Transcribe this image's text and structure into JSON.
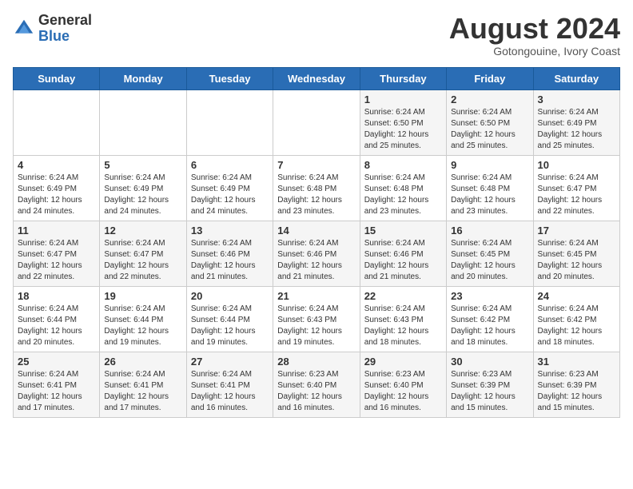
{
  "header": {
    "logo_general": "General",
    "logo_blue": "Blue",
    "month_title": "August 2024",
    "subtitle": "Gotongouine, Ivory Coast"
  },
  "weekdays": [
    "Sunday",
    "Monday",
    "Tuesday",
    "Wednesday",
    "Thursday",
    "Friday",
    "Saturday"
  ],
  "weeks": [
    [
      {
        "day": "",
        "info": ""
      },
      {
        "day": "",
        "info": ""
      },
      {
        "day": "",
        "info": ""
      },
      {
        "day": "",
        "info": ""
      },
      {
        "day": "1",
        "info": "Sunrise: 6:24 AM\nSunset: 6:50 PM\nDaylight: 12 hours\nand 25 minutes."
      },
      {
        "day": "2",
        "info": "Sunrise: 6:24 AM\nSunset: 6:50 PM\nDaylight: 12 hours\nand 25 minutes."
      },
      {
        "day": "3",
        "info": "Sunrise: 6:24 AM\nSunset: 6:49 PM\nDaylight: 12 hours\nand 25 minutes."
      }
    ],
    [
      {
        "day": "4",
        "info": "Sunrise: 6:24 AM\nSunset: 6:49 PM\nDaylight: 12 hours\nand 24 minutes."
      },
      {
        "day": "5",
        "info": "Sunrise: 6:24 AM\nSunset: 6:49 PM\nDaylight: 12 hours\nand 24 minutes."
      },
      {
        "day": "6",
        "info": "Sunrise: 6:24 AM\nSunset: 6:49 PM\nDaylight: 12 hours\nand 24 minutes."
      },
      {
        "day": "7",
        "info": "Sunrise: 6:24 AM\nSunset: 6:48 PM\nDaylight: 12 hours\nand 23 minutes."
      },
      {
        "day": "8",
        "info": "Sunrise: 6:24 AM\nSunset: 6:48 PM\nDaylight: 12 hours\nand 23 minutes."
      },
      {
        "day": "9",
        "info": "Sunrise: 6:24 AM\nSunset: 6:48 PM\nDaylight: 12 hours\nand 23 minutes."
      },
      {
        "day": "10",
        "info": "Sunrise: 6:24 AM\nSunset: 6:47 PM\nDaylight: 12 hours\nand 22 minutes."
      }
    ],
    [
      {
        "day": "11",
        "info": "Sunrise: 6:24 AM\nSunset: 6:47 PM\nDaylight: 12 hours\nand 22 minutes."
      },
      {
        "day": "12",
        "info": "Sunrise: 6:24 AM\nSunset: 6:47 PM\nDaylight: 12 hours\nand 22 minutes."
      },
      {
        "day": "13",
        "info": "Sunrise: 6:24 AM\nSunset: 6:46 PM\nDaylight: 12 hours\nand 21 minutes."
      },
      {
        "day": "14",
        "info": "Sunrise: 6:24 AM\nSunset: 6:46 PM\nDaylight: 12 hours\nand 21 minutes."
      },
      {
        "day": "15",
        "info": "Sunrise: 6:24 AM\nSunset: 6:46 PM\nDaylight: 12 hours\nand 21 minutes."
      },
      {
        "day": "16",
        "info": "Sunrise: 6:24 AM\nSunset: 6:45 PM\nDaylight: 12 hours\nand 20 minutes."
      },
      {
        "day": "17",
        "info": "Sunrise: 6:24 AM\nSunset: 6:45 PM\nDaylight: 12 hours\nand 20 minutes."
      }
    ],
    [
      {
        "day": "18",
        "info": "Sunrise: 6:24 AM\nSunset: 6:44 PM\nDaylight: 12 hours\nand 20 minutes."
      },
      {
        "day": "19",
        "info": "Sunrise: 6:24 AM\nSunset: 6:44 PM\nDaylight: 12 hours\nand 19 minutes."
      },
      {
        "day": "20",
        "info": "Sunrise: 6:24 AM\nSunset: 6:44 PM\nDaylight: 12 hours\nand 19 minutes."
      },
      {
        "day": "21",
        "info": "Sunrise: 6:24 AM\nSunset: 6:43 PM\nDaylight: 12 hours\nand 19 minutes."
      },
      {
        "day": "22",
        "info": "Sunrise: 6:24 AM\nSunset: 6:43 PM\nDaylight: 12 hours\nand 18 minutes."
      },
      {
        "day": "23",
        "info": "Sunrise: 6:24 AM\nSunset: 6:42 PM\nDaylight: 12 hours\nand 18 minutes."
      },
      {
        "day": "24",
        "info": "Sunrise: 6:24 AM\nSunset: 6:42 PM\nDaylight: 12 hours\nand 18 minutes."
      }
    ],
    [
      {
        "day": "25",
        "info": "Sunrise: 6:24 AM\nSunset: 6:41 PM\nDaylight: 12 hours\nand 17 minutes."
      },
      {
        "day": "26",
        "info": "Sunrise: 6:24 AM\nSunset: 6:41 PM\nDaylight: 12 hours\nand 17 minutes."
      },
      {
        "day": "27",
        "info": "Sunrise: 6:24 AM\nSunset: 6:41 PM\nDaylight: 12 hours\nand 16 minutes."
      },
      {
        "day": "28",
        "info": "Sunrise: 6:23 AM\nSunset: 6:40 PM\nDaylight: 12 hours\nand 16 minutes."
      },
      {
        "day": "29",
        "info": "Sunrise: 6:23 AM\nSunset: 6:40 PM\nDaylight: 12 hours\nand 16 minutes."
      },
      {
        "day": "30",
        "info": "Sunrise: 6:23 AM\nSunset: 6:39 PM\nDaylight: 12 hours\nand 15 minutes."
      },
      {
        "day": "31",
        "info": "Sunrise: 6:23 AM\nSunset: 6:39 PM\nDaylight: 12 hours\nand 15 minutes."
      }
    ]
  ]
}
